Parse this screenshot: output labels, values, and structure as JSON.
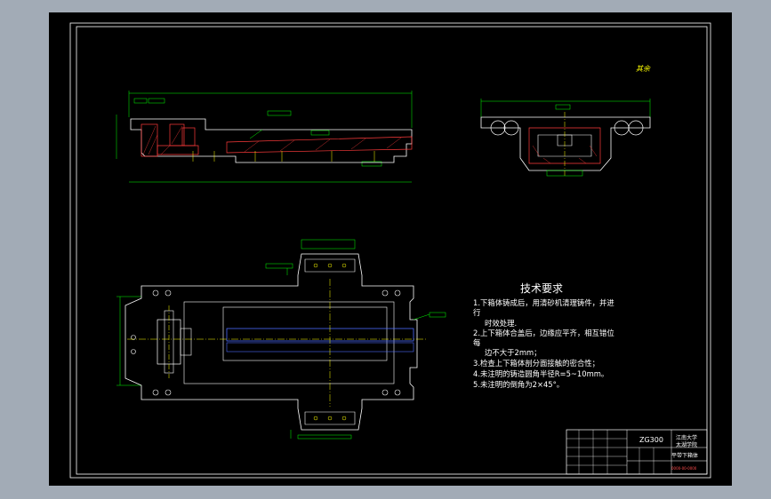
{
  "technical_requirements": {
    "title": "技术要求",
    "items": [
      "1.下箱体铸成后，用清砂机清理铸件，并进",
      "行",
      "时效处理.",
      "2.上下箱体合盖后，边缘应平齐，相互错位",
      "每",
      "边不大于2mm；",
      "3.检查上下箱体剖分面接触的密合性；",
      "4.未注明的铸造圆角半径R=5~10mm。",
      "5.未注明的倒角为2×45°。"
    ]
  },
  "roughness_note": "其余",
  "title_block": {
    "model": "ZG300",
    "school_line1": "江南大学",
    "school_line2": "太湖学院",
    "part_name": "平带下箱体",
    "drawing_no": "0000-00-0000"
  },
  "colors": {
    "background": "#000000",
    "frame": "#ffffff",
    "outline": "#ffffff",
    "dimension": "#00ff00",
    "center": "#ffff00",
    "shaft": "#4d6bff",
    "hatch": "#ff3b3b"
  }
}
